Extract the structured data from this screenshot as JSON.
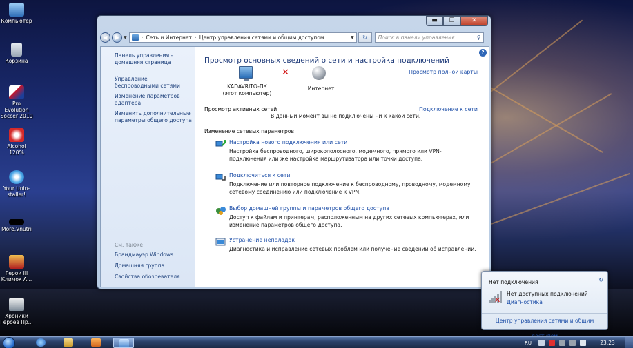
{
  "desktop": {
    "icons": [
      {
        "label": "Компьютер"
      },
      {
        "label": "Корзина"
      },
      {
        "label": "Pro Evolution Soccer 2010"
      },
      {
        "label": "Alcohol 120%"
      },
      {
        "label": "Your Unin-staller!"
      },
      {
        "label": "More.Vnutri"
      },
      {
        "label": "Герои III Климок А..."
      },
      {
        "label": "Хроники Героев Пр..."
      }
    ]
  },
  "window": {
    "controls": {
      "minimize": "▬",
      "maximize": "☐",
      "close": "✕"
    },
    "nav": {
      "back": "◀",
      "forward": "▶"
    },
    "address": {
      "segment1": "Сеть и Интернет",
      "separator": "›",
      "segment2": "Центр управления сетями и общим доступом"
    },
    "search_placeholder": "Поиск в панели управления",
    "left_pane": {
      "links": [
        "Панель управления - домашняя страница",
        "Управление беспроводными сетями",
        "Изменение параметров адаптера",
        "Изменить дополнительные параметры общего доступа"
      ],
      "see_also_label": "См. также",
      "see_also": [
        "Брандмауэр Windows",
        "Домашняя группа",
        "Свойства обозревателя"
      ]
    },
    "main": {
      "title": "Просмотр основных сведений о сети и настройка подключений",
      "full_map_link": "Просмотр полной карты",
      "diagram": {
        "computer_name": "KADAVRITO-ПК",
        "computer_sub": "(этот компьютер)",
        "internet_label": "Интернет"
      },
      "active_networks_label": "Просмотр активных сетей",
      "connect_link": "Подключение к сети",
      "not_connected_text": "В данный момент вы не подключены ни к какой сети.",
      "change_settings_label": "Изменение сетевых параметров",
      "tasks": [
        {
          "link": "Настройка нового подключения или сети",
          "desc": "Настройка беспроводного, широкополосного, модемного, прямого или VPN-подключения или же настройка маршрутизатора или точки доступа."
        },
        {
          "link": "Подключиться к сети",
          "desc": "Подключение или повторное подключение к беспроводному, проводному, модемному сетевому соединению или подключение к VPN."
        },
        {
          "link": "Выбор домашней группы и параметров общего доступа",
          "desc": "Доступ к файлам и принтерам, расположенным на других сетевых компьютерах, или изменение параметров общего доступа."
        },
        {
          "link": "Устранение неполадок",
          "desc": "Диагностика и исправление сетевых проблем или получение сведений об исправлении."
        }
      ]
    }
  },
  "popup": {
    "title": "Нет подключения",
    "line1": "Нет доступных подключений",
    "line2": "Диагностика",
    "footer": "Центр управления сетями и общим доступом"
  },
  "taskbar": {
    "lang": "RU",
    "time": "23:23"
  }
}
